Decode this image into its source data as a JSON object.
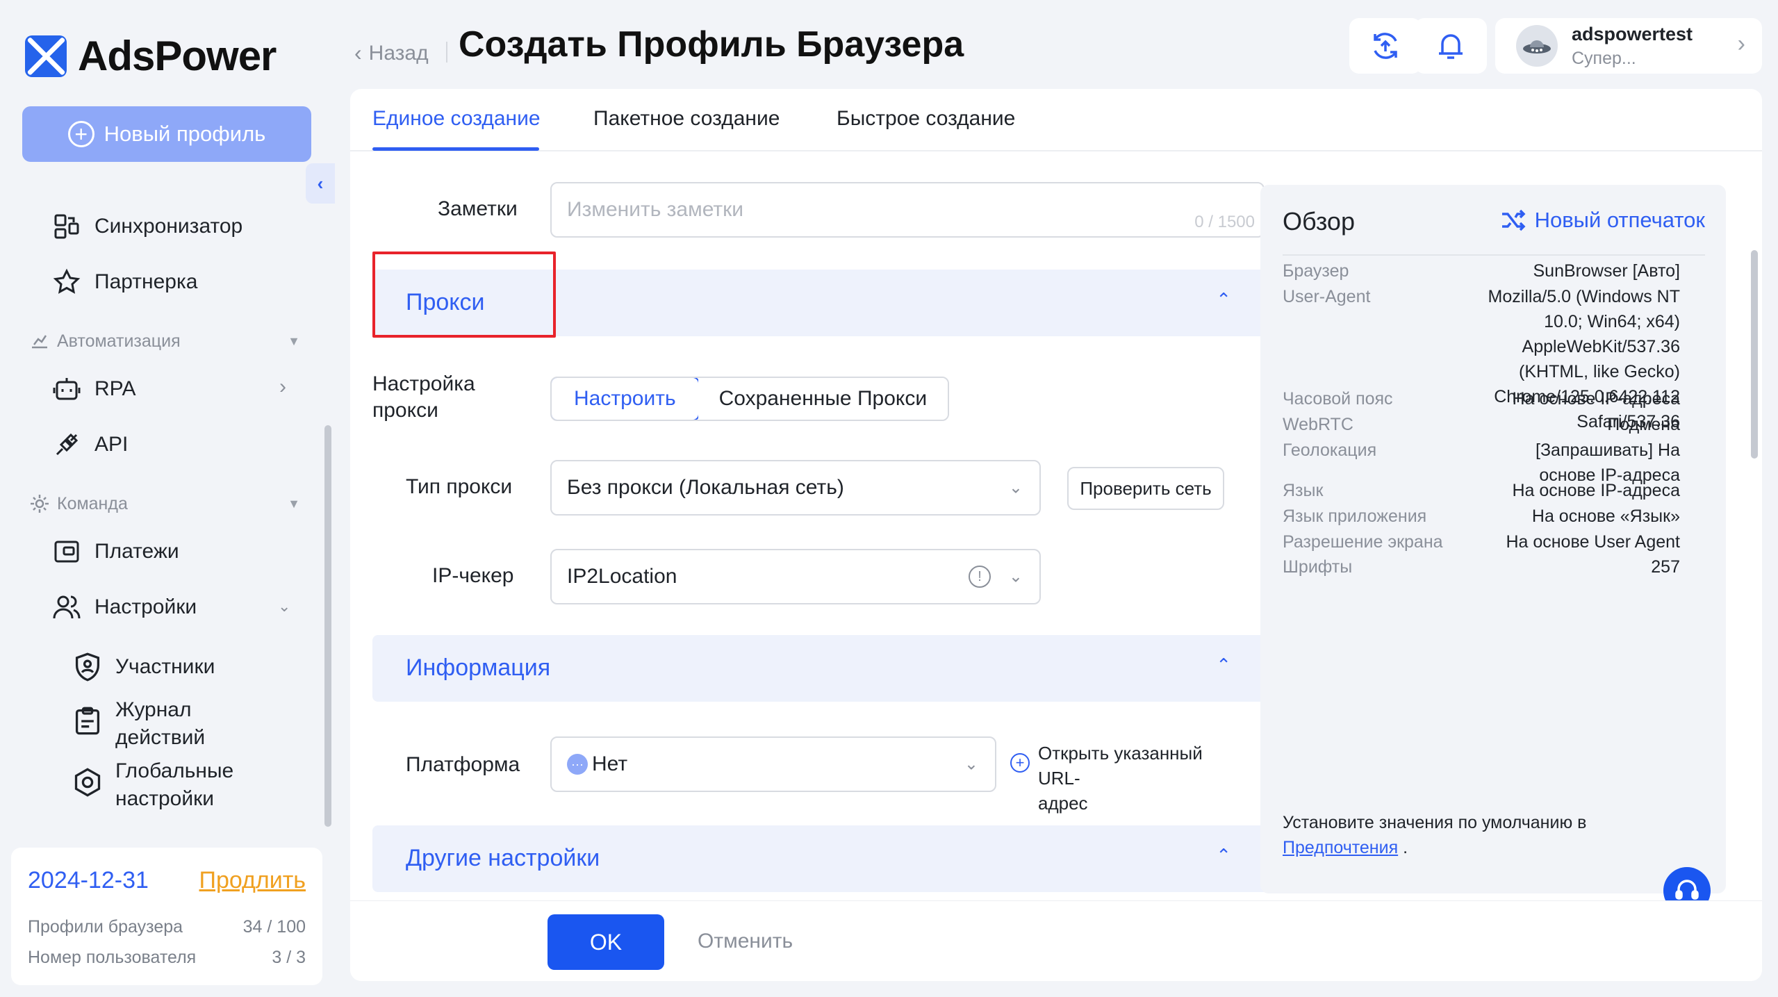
{
  "app": {
    "name": "AdsPower"
  },
  "sidebar": {
    "new_profile_label": "Новый профиль",
    "items": {
      "synchronizer": "Синхронизатор",
      "partner": "Партнерка",
      "automation_group": "Автоматизация",
      "rpa": "RPA",
      "api": "API",
      "team_group": "Команда",
      "payments": "Платежи",
      "settings": "Настройки",
      "members": "Участники",
      "activity_log_line1": "Журнал",
      "activity_log_line2": "действий",
      "global_settings_line1": "Глобальные",
      "global_settings_line2": "настройки"
    },
    "plan": {
      "expiry_date": "2024-12-31",
      "renew_label": "Продлить",
      "profiles_label": "Профили браузера",
      "profiles_value": "34 / 100",
      "users_label": "Номер пользователя",
      "users_value": "3 / 3"
    }
  },
  "header": {
    "back_label": "Назад",
    "title": "Создать Профиль Браузера",
    "user": {
      "name": "adspowertest",
      "role": "Супер..."
    }
  },
  "tabs": [
    {
      "label": "Единое создание",
      "active": true
    },
    {
      "label": "Пакетное создание",
      "active": false
    },
    {
      "label": "Быстрое создание",
      "active": false
    }
  ],
  "form": {
    "notes_label": "Заметки",
    "notes_placeholder": "Изменить заметки",
    "notes_counter": "0 / 1500",
    "proxy_section_title": "Прокси",
    "proxy_setting_label_line1": "Настройка",
    "proxy_setting_label_line2": "прокси",
    "proxy_setting_options": [
      "Настроить",
      "Сохраненные Прокси"
    ],
    "proxy_type_label": "Тип прокси",
    "proxy_type_value": "Без прокси (Локальная сеть)",
    "check_network_label": "Проверить сеть",
    "ip_checker_label": "IP-чекер",
    "ip_checker_value": "IP2Location",
    "info_section_title": "Информация",
    "platform_label": "Платформа",
    "platform_value": "Нет",
    "open_url_line1": "Открыть указанный URL-",
    "open_url_line2": "адрес",
    "other_section_title": "Другие настройки"
  },
  "footer": {
    "ok_label": "OK",
    "cancel_label": "Отменить"
  },
  "overview": {
    "title": "Обзор",
    "new_fingerprint_label": "Новый отпечаток",
    "rows": [
      {
        "key": "Браузер",
        "value": [
          "SunBrowser [Авто]"
        ]
      },
      {
        "key": "User-Agent",
        "value": [
          "Mozilla/5.0 (Windows NT",
          "10.0; Win64; x64)",
          "AppleWebKit/537.36",
          "(KHTML, like Gecko)",
          "Chrome/125.0.6422.112",
          "Safari/537.36"
        ]
      },
      {
        "key": "Часовой пояс",
        "value": [
          "На основе IP-адреса"
        ]
      },
      {
        "key": "WebRTC",
        "value": [
          "Подмена"
        ]
      },
      {
        "key": "Геолокация",
        "value": [
          "[Запрашивать] На",
          "основе IP-адреса"
        ]
      },
      {
        "key": "Язык",
        "value": [
          "На основе IP-адреса"
        ]
      },
      {
        "key": "Язык приложения",
        "value": [
          "На основе «Язык»"
        ]
      },
      {
        "key": "Разрешение экрана",
        "value": [
          "На основе User Agent"
        ]
      },
      {
        "key": "Шрифты",
        "value": [
          "257"
        ]
      }
    ],
    "note_text": "Установите значения по умолчанию в",
    "note_link": "Предпочтения",
    "note_end": " ."
  },
  "colors": {
    "accent": "#2f5ef2",
    "highlight": "#e8232b",
    "renew": "#f0a020"
  }
}
